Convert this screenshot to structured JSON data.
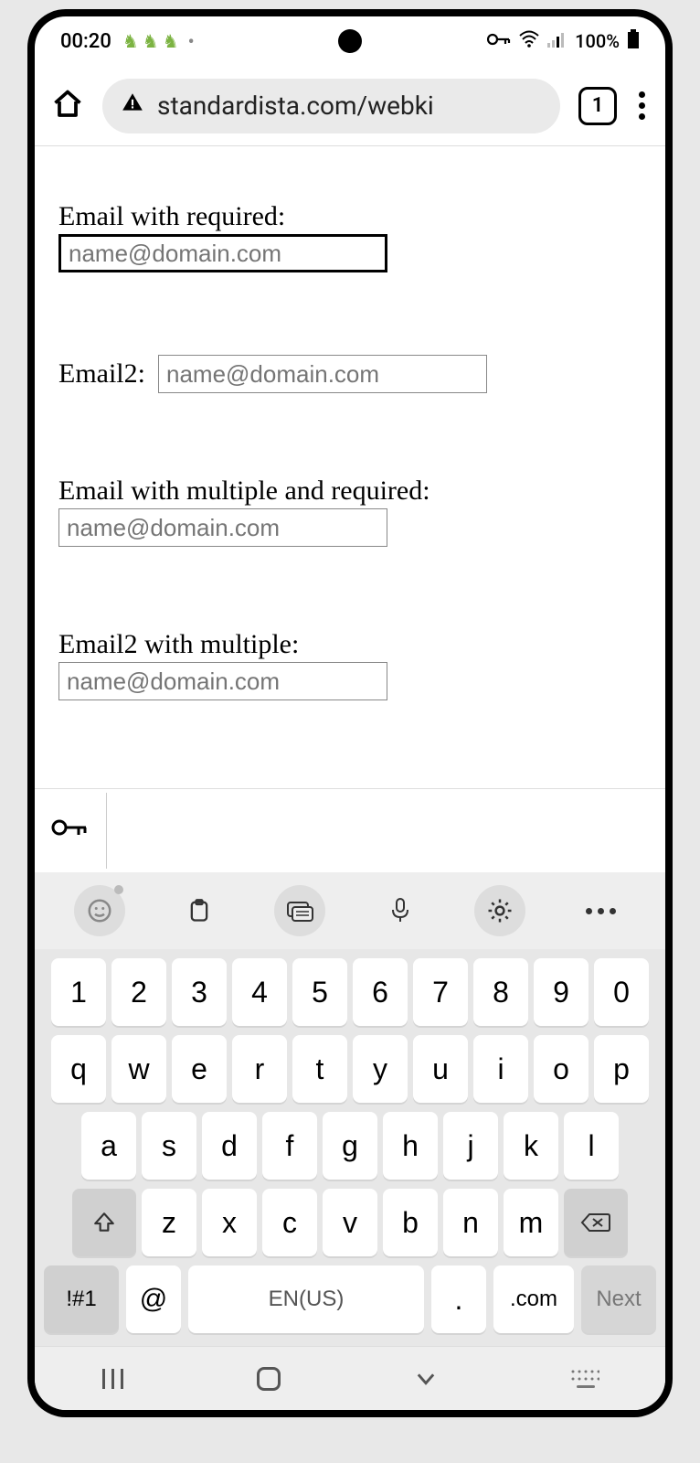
{
  "status": {
    "time": "00:20",
    "battery": "100%"
  },
  "browser": {
    "url": "standardista.com/webki",
    "tab_count": "1"
  },
  "form": {
    "fields": [
      {
        "label": "Email with required:",
        "placeholder": "name@domain.com",
        "focused": true,
        "inline": false
      },
      {
        "label": "Email2:",
        "placeholder": "name@domain.com",
        "focused": false,
        "inline": true
      },
      {
        "label": "Email with multiple and required:",
        "placeholder": "name@domain.com",
        "focused": false,
        "inline": false
      },
      {
        "label": "Email2 with multiple:",
        "placeholder": "name@domain.com",
        "focused": false,
        "inline": false
      }
    ]
  },
  "keyboard": {
    "row_num": [
      "1",
      "2",
      "3",
      "4",
      "5",
      "6",
      "7",
      "8",
      "9",
      "0"
    ],
    "row1": [
      "q",
      "w",
      "e",
      "r",
      "t",
      "y",
      "u",
      "i",
      "o",
      "p"
    ],
    "row2": [
      "a",
      "s",
      "d",
      "f",
      "g",
      "h",
      "j",
      "k",
      "l"
    ],
    "row3": [
      "z",
      "x",
      "c",
      "v",
      "b",
      "n",
      "m"
    ],
    "sym": "!#1",
    "at": "@",
    "space": "EN(US)",
    "period": ".",
    "dotcom": ".com",
    "next": "Next"
  }
}
